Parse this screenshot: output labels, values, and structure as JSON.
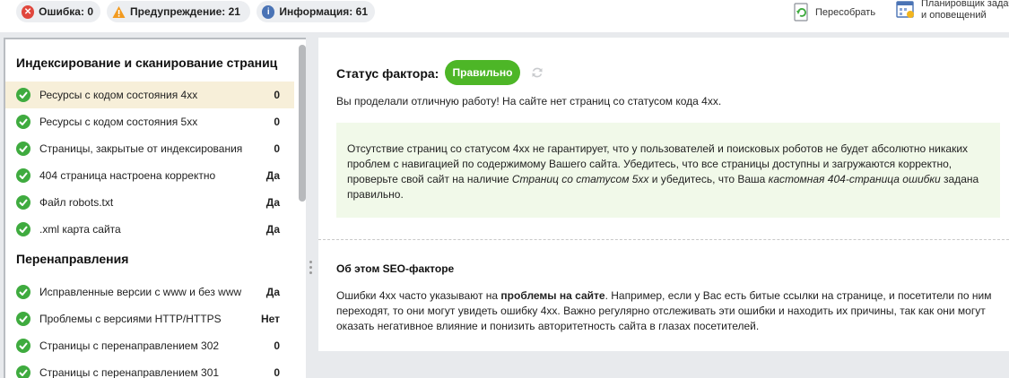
{
  "topbar": {
    "error": {
      "label": "Ошибка:",
      "count": "0",
      "icon": "error-icon",
      "color": "#e0473d"
    },
    "warning": {
      "label": "Предупреждение:",
      "count": "21",
      "icon": "warning-icon",
      "color": "#f29a1f"
    },
    "info": {
      "label": "Информация:",
      "count": "61",
      "icon": "info-icon",
      "color": "#4a73b5"
    },
    "rebuild_label": "Пересобрать",
    "scheduler_label_line1": "Планировщик задач",
    "scheduler_label_line2": "и оповещений"
  },
  "sidebar": {
    "sections": [
      {
        "title": "Индексирование и сканирование страниц",
        "items": [
          {
            "label": "Ресурсы с кодом состояния 4xx",
            "value": "0",
            "active": true
          },
          {
            "label": "Ресурсы с кодом состояния 5xx",
            "value": "0"
          },
          {
            "label": "Страницы, закрытые от индексирования",
            "value": "0"
          },
          {
            "label": "404 страница настроена корректно",
            "value": "Да"
          },
          {
            "label": "Файл robots.txt",
            "value": "Да"
          },
          {
            "label": ".xml карта сайта",
            "value": "Да"
          }
        ]
      },
      {
        "title": "Перенаправления",
        "items": [
          {
            "label": "Исправленные версии с www и без www",
            "value": "Да"
          },
          {
            "label": "Проблемы с версиями HTTP/HTTPS",
            "value": "Нет"
          },
          {
            "label": "Страницы с перенаправлением 302",
            "value": "0"
          },
          {
            "label": "Страницы с перенаправлением 301",
            "value": "0"
          }
        ]
      }
    ]
  },
  "detail": {
    "status_label": "Статус фактора:",
    "status_value": "Правильно",
    "status_color": "#4db627",
    "intro": "Вы проделали отличную работу! На сайте нет страниц со статусом кода 4xx.",
    "note_part1": "Отсутствие страниц со статусом 4xx не гарантирует, что у пользователей и поисковых роботов не будет абсолютно никаких проблем с навигацией по содержимому Вашего сайта. Убедитесь, что все страницы доступны и загружаются корректно, проверьте свой сайт на наличие ",
    "note_link1": "Страниц со статусом 5xx",
    "note_part2": " и убедитесь, что Ваша ",
    "note_link2": "кастомная 404-страница ошибки",
    "note_part3": " задана правильно.",
    "about_title": "Об этом SEO-факторе",
    "about_part1": "Ошибки 4xx часто указывают на ",
    "about_bold": "проблемы на сайте",
    "about_part2": ". Например, если у Вас есть битые ссылки на странице, и посетители по ним переходят, то они могут увидеть ошибку 4xx. Важно регулярно отслеживать эти ошибки и находить их причины, так как они могут оказать негативное влияние и понизить авторитетность сайта в глазах посетителей."
  }
}
